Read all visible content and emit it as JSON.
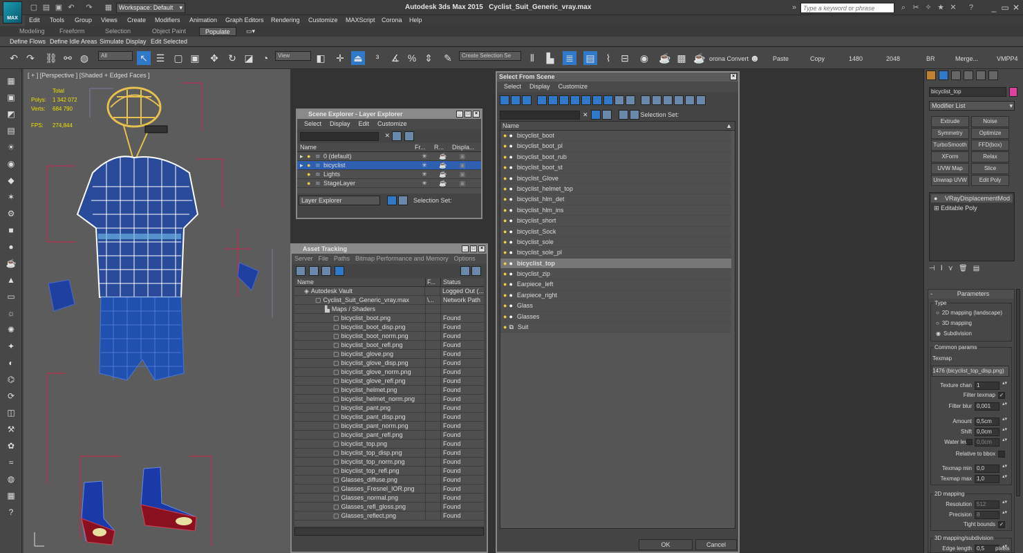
{
  "title": {
    "workspace": "Workspace: Default",
    "app": "Autodesk 3ds Max  2015",
    "file": "Cyclist_Suit_Generic_vray.max",
    "search_placeholder": "Type a keyword or phrase",
    "logo": "MAX"
  },
  "menu": [
    "Edit",
    "Tools",
    "Group",
    "Views",
    "Create",
    "Modifiers",
    "Animation",
    "Graph Editors",
    "Rendering",
    "Customize",
    "MAXScript",
    "Corona",
    "Help"
  ],
  "ribbon_tabs": [
    "Modeling",
    "Freeform",
    "Selection",
    "Object Paint",
    "Populate"
  ],
  "ribbon_buttons": [
    "Define Flows",
    "Define Idle Areas",
    "Simulate",
    "Display",
    "Edit Selected"
  ],
  "toolbar": {
    "filter": "All",
    "view": "View",
    "create_selection_set": "Create Selection Se",
    "corona_convert": "orona Convert",
    "paste": "Paste",
    "copy": "Copy",
    "res_w": "1480",
    "res_h": "2048",
    "br": "BR",
    "merge": "Merge...",
    "vmpp": "VMPP4"
  },
  "viewport": {
    "label": "[ + ] [Perspective ] [Shaded + Edged Faces ]",
    "total": "Total",
    "polys_label": "Polys:",
    "polys_value": "1 342 072",
    "verts_label": "Verts:",
    "verts_value": "684 790",
    "fps_label": "FPS:",
    "fps_value": "274,844"
  },
  "scene_explorer": {
    "title": "Scene Explorer - Layer Explorer",
    "menu": [
      "Select",
      "Display",
      "Edit",
      "Customize"
    ],
    "columns": [
      "Name",
      "Fr...",
      "R...",
      "Displa..."
    ],
    "layers": [
      {
        "name": "0 (default)",
        "selected": false
      },
      {
        "name": "bicyclist",
        "selected": true
      },
      {
        "name": "Lights",
        "selected": false
      },
      {
        "name": "StageLayer",
        "selected": false
      }
    ],
    "footer_dropdown": "Layer Explorer",
    "selection_set": "Selection Set:"
  },
  "asset_tracking": {
    "title": "Asset Tracking",
    "menu": [
      "Server",
      "File",
      "Paths",
      "Bitmap Performance and Memory",
      "Options"
    ],
    "columns": [
      "Name",
      "F...",
      "Status"
    ],
    "rows": [
      {
        "name": "Autodesk Vault",
        "f": "",
        "status": "Logged Out (..."
      },
      {
        "name": "Cyclist_Suit_Generic_vray.max",
        "f": "\\...",
        "status": "Network Path"
      },
      {
        "name": "Maps / Shaders",
        "f": "",
        "status": ""
      },
      {
        "name": "bicyclist_boot.png",
        "f": "",
        "status": "Found"
      },
      {
        "name": "bicyclist_boot_disp.png",
        "f": "",
        "status": "Found"
      },
      {
        "name": "bicyclist_boot_norm.png",
        "f": "",
        "status": "Found"
      },
      {
        "name": "bicyclist_boot_refl.png",
        "f": "",
        "status": "Found"
      },
      {
        "name": "bicyclist_glove.png",
        "f": "",
        "status": "Found"
      },
      {
        "name": "bicyclist_glove_disp.png",
        "f": "",
        "status": "Found"
      },
      {
        "name": "bicyclist_glove_norm.png",
        "f": "",
        "status": "Found"
      },
      {
        "name": "bicyclist_glove_refl.png",
        "f": "",
        "status": "Found"
      },
      {
        "name": "bicyclist_helmet.png",
        "f": "",
        "status": "Found"
      },
      {
        "name": "bicyclist_helmet_norm.png",
        "f": "",
        "status": "Found"
      },
      {
        "name": "bicyclist_pant.png",
        "f": "",
        "status": "Found"
      },
      {
        "name": "bicyclist_pant_disp.png",
        "f": "",
        "status": "Found"
      },
      {
        "name": "bicyclist_pant_norm.png",
        "f": "",
        "status": "Found"
      },
      {
        "name": "bicyclist_pant_refl.png",
        "f": "",
        "status": "Found"
      },
      {
        "name": "bicyclist_top.png",
        "f": "",
        "status": "Found"
      },
      {
        "name": "bicyclist_top_disp.png",
        "f": "",
        "status": "Found"
      },
      {
        "name": "bicyclist_top_norm.png",
        "f": "",
        "status": "Found"
      },
      {
        "name": "bicyclist_top_refl.png",
        "f": "",
        "status": "Found"
      },
      {
        "name": "Glasses_diffuse.png",
        "f": "",
        "status": "Found"
      },
      {
        "name": "Glasses_Fresnel_IOR.png",
        "f": "",
        "status": "Found"
      },
      {
        "name": "Glasses_normal.png",
        "f": "",
        "status": "Found"
      },
      {
        "name": "Glasses_refl_gloss.png",
        "f": "",
        "status": "Found"
      },
      {
        "name": "Glasses_reflect.png",
        "f": "",
        "status": "Found"
      }
    ]
  },
  "select_from_scene": {
    "title": "Select From Scene",
    "menu": [
      "Select",
      "Display",
      "Customize"
    ],
    "selection_set": "Selection Set:",
    "column": "Name",
    "items": [
      {
        "name": "bicyclist_boot",
        "selected": false
      },
      {
        "name": "bicyclist_boot_pl",
        "selected": false
      },
      {
        "name": "bicyclist_boot_rub",
        "selected": false
      },
      {
        "name": "bicyclist_boot_st",
        "selected": false
      },
      {
        "name": "bicyclist_Glove",
        "selected": false
      },
      {
        "name": "bicyclist_helmet_top",
        "selected": false
      },
      {
        "name": "bicyclist_hlm_det",
        "selected": false
      },
      {
        "name": "bicyclist_hlm_ins",
        "selected": false
      },
      {
        "name": "bicyclist_short",
        "selected": false
      },
      {
        "name": "bicyclist_Sock",
        "selected": false
      },
      {
        "name": "bicyclist_sole",
        "selected": false
      },
      {
        "name": "bicyclist_sole_pl",
        "selected": false
      },
      {
        "name": "bicyclist_top",
        "selected": true
      },
      {
        "name": "bicyclist_zip",
        "selected": false
      },
      {
        "name": "Earpiece_left",
        "selected": false
      },
      {
        "name": "Earpiece_right",
        "selected": false
      },
      {
        "name": "Glass",
        "selected": false
      },
      {
        "name": "Glasses",
        "selected": false
      },
      {
        "name": "Suit",
        "selected": false
      }
    ],
    "ok": "OK",
    "cancel": "Cancel"
  },
  "command_panel": {
    "object_name": "bicyclist_top",
    "object_color": "#e040a0",
    "modifier_list": "Modifier List",
    "buttons": [
      "Extrude",
      "Noise",
      "Symmetry",
      "Optimize",
      "TurboSmooth",
      "FFD(box)",
      "XForm",
      "Relax",
      "UVW Map",
      "Slice",
      "Unwrap UVW",
      "Edit Poly"
    ],
    "stack": [
      "VRayDisplacementMod",
      "Editable Poly"
    ],
    "parameters": "Parameters",
    "type_label": "Type",
    "type_options": [
      "2D mapping (landscape)",
      "3D mapping",
      "Subdivision"
    ],
    "type_selected": 2,
    "common_params": "Common params",
    "texmap_label": "Texmap",
    "texmap_value": "1476 (bicyclist_top_disp.png)",
    "texture_chan_label": "Texture chan",
    "texture_chan": "1",
    "filter_texmap": "Filter texmap",
    "filter_blur_label": "Filter blur",
    "filter_blur": "0,001",
    "amount_label": "Amount",
    "amount": "0,5cm",
    "shift_label": "Shift",
    "shift": "0,0cm",
    "water_level_label": "Water level",
    "water_level": "0,0cm",
    "relative_bbox": "Relative to bbox",
    "texmap_min_label": "Texmap min",
    "texmap_min": "0,0",
    "texmap_max_label": "Texmap max",
    "texmap_max": "1,0",
    "mapping2d": "2D mapping",
    "resolution_label": "Resolution",
    "resolution": "512",
    "precision_label": "Precision",
    "precision": "8",
    "tight_bounds": "Tight bounds",
    "mapping3d": "3D mapping/subdivision",
    "edge_length_label": "Edge length",
    "edge_length": "0,5",
    "pixels": "pixels"
  }
}
